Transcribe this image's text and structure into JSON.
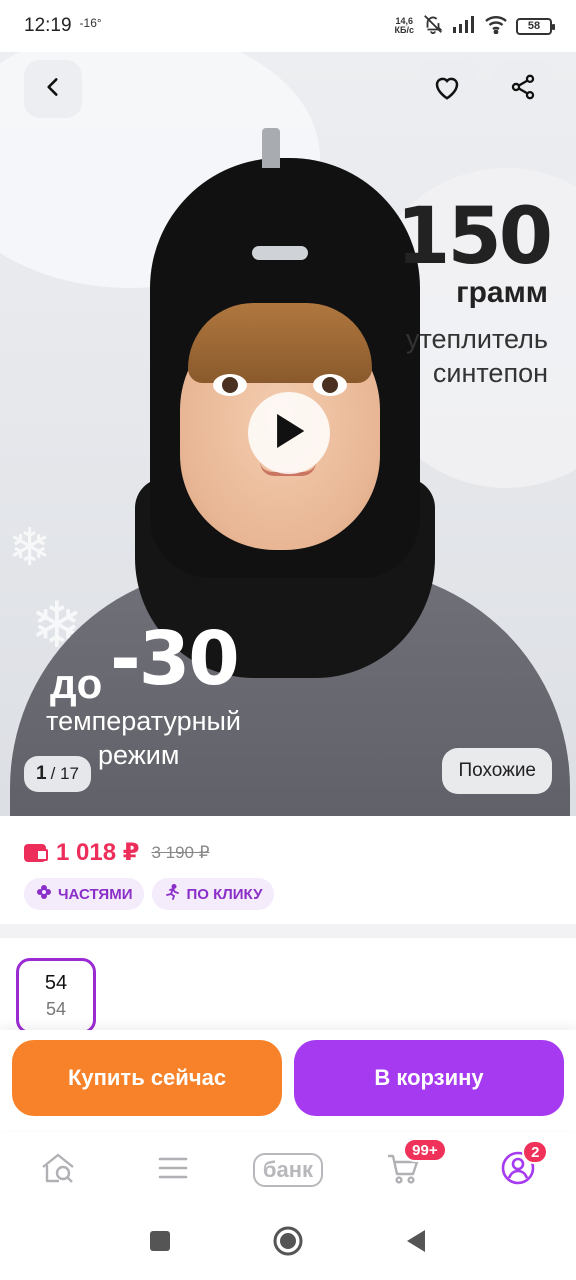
{
  "status_bar": {
    "time": "12:19",
    "temperature": "-16°",
    "net_speed_value": "14,6",
    "net_speed_unit": "КБ/с",
    "battery": "58"
  },
  "hero": {
    "promo_value": "150",
    "promo_unit": "грамм",
    "promo_line1": "утеплитель",
    "promo_line2": "синтепон",
    "temp_prefix": "до",
    "temp_value": "-30",
    "temp_line1": "температурный",
    "temp_line2": "режим",
    "counter_current": "1",
    "counter_total": "/ 17",
    "similar_label": "Похожие",
    "icons": {
      "back": "chevron-left-icon",
      "favorite": "heart-icon",
      "share": "share-icon",
      "play": "play-icon"
    }
  },
  "price": {
    "current": "1 018 ₽",
    "old": "3 190 ₽",
    "chips": [
      {
        "label": "ЧАСТЯМИ",
        "icon": "flower-icon"
      },
      {
        "label": "ПО КЛИКУ",
        "icon": "running-icon"
      }
    ]
  },
  "size": {
    "selected_main": "54",
    "selected_sub": "54"
  },
  "actions": {
    "buy_now": "Купить сейчас",
    "add_to_cart": "В корзину"
  },
  "bottom_nav": {
    "items": [
      {
        "name": "home",
        "icon": "home-search-icon"
      },
      {
        "name": "catalog",
        "icon": "menu-icon"
      },
      {
        "name": "bank",
        "label": "банк"
      },
      {
        "name": "cart",
        "icon": "cart-icon",
        "badge": "99+"
      },
      {
        "name": "profile",
        "icon": "profile-icon",
        "badge": "2"
      }
    ]
  },
  "colors": {
    "accent_purple": "#a53af0",
    "accent_orange": "#f7822a",
    "price_red": "#ee2e5a"
  }
}
